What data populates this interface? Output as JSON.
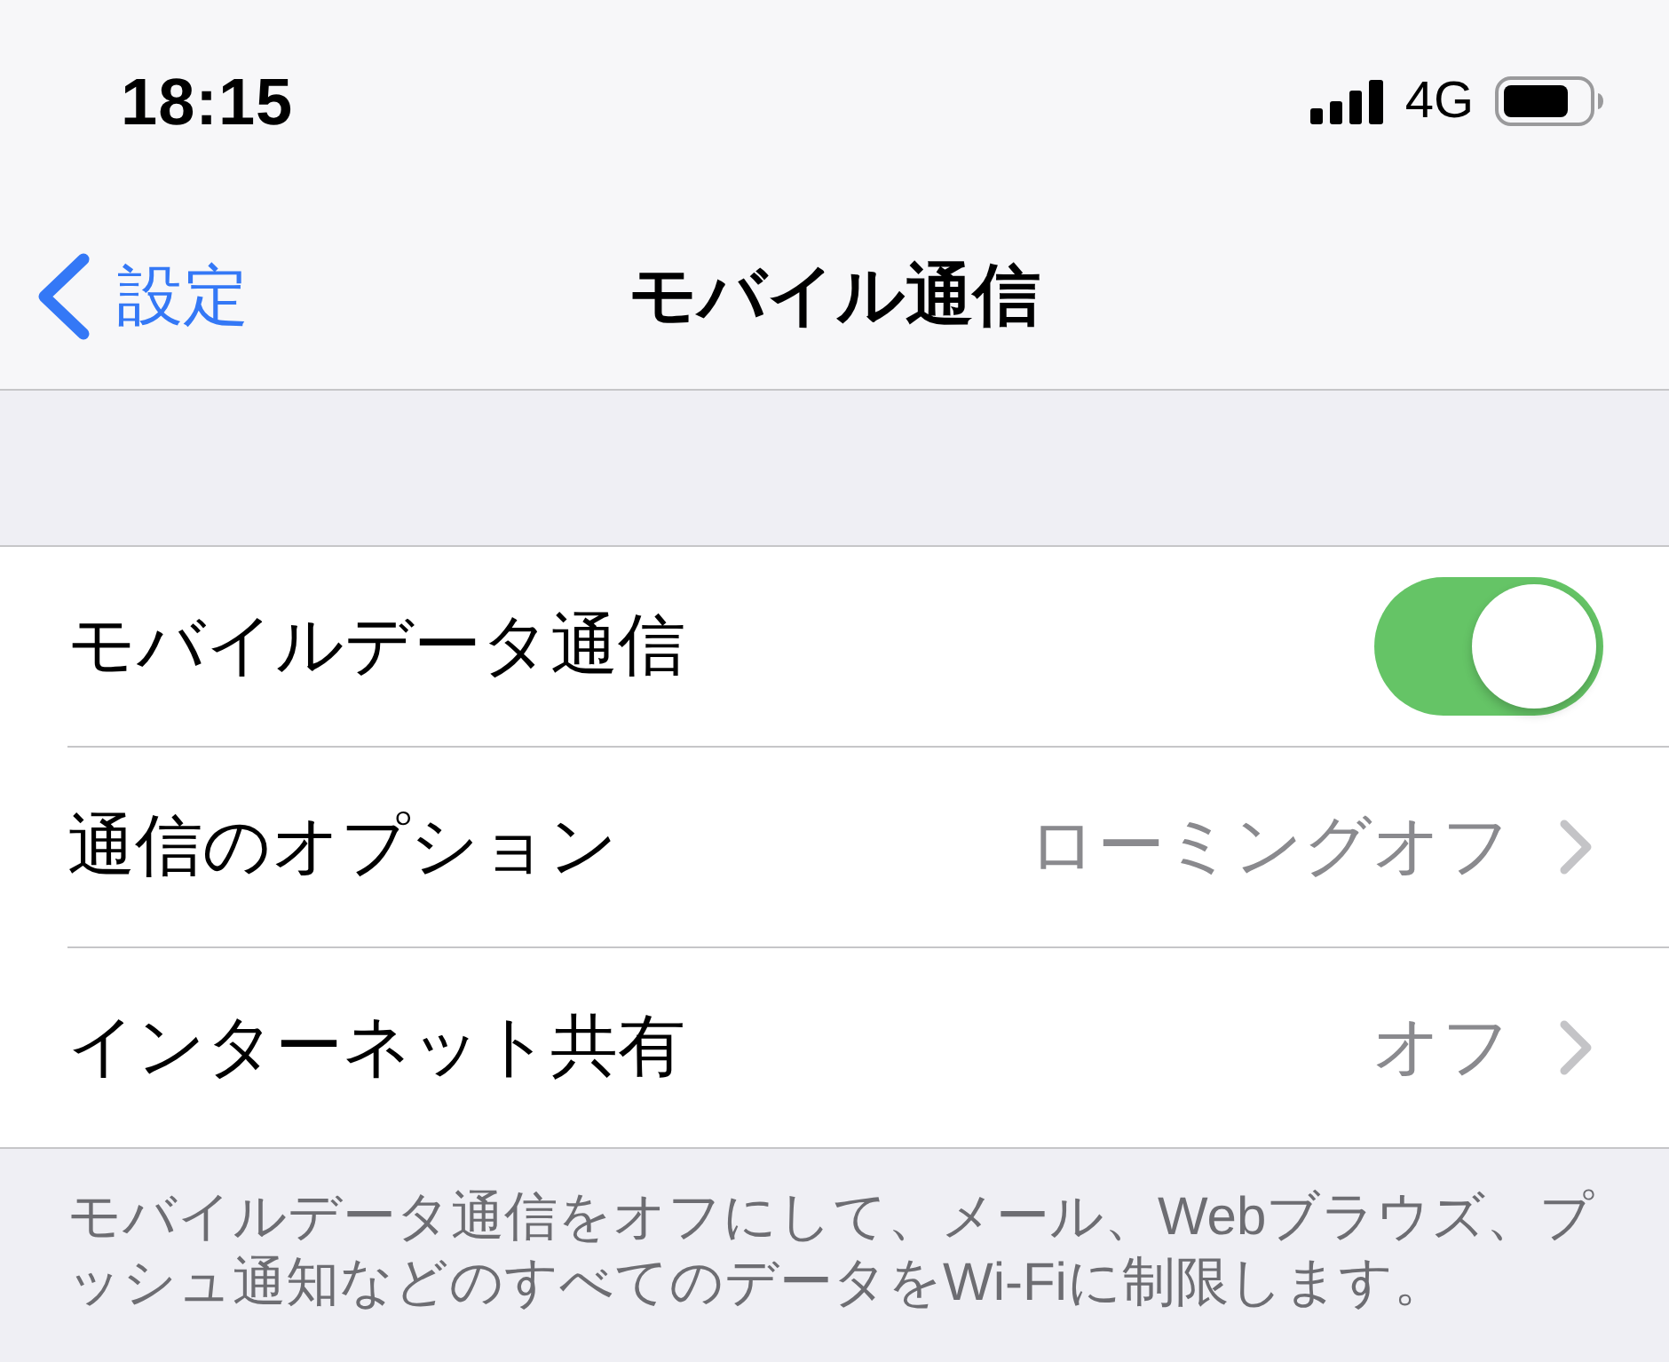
{
  "status_bar": {
    "time": "18:15",
    "network": "4G"
  },
  "nav_bar": {
    "back_label": "設定",
    "title": "モバイル通信"
  },
  "rows": [
    {
      "kind": "toggle",
      "label": "モバイルデータ通信",
      "on": true
    },
    {
      "kind": "link",
      "label": "通信のオプション",
      "value": "ローミングオフ"
    },
    {
      "kind": "link",
      "label": "インターネット共有",
      "value": "オフ"
    }
  ],
  "footer": "モバイルデータ通信をオフにして、メール、Webブラウズ、プッシュ通知などのすべてのデータをWi-Fiに制限します。"
}
